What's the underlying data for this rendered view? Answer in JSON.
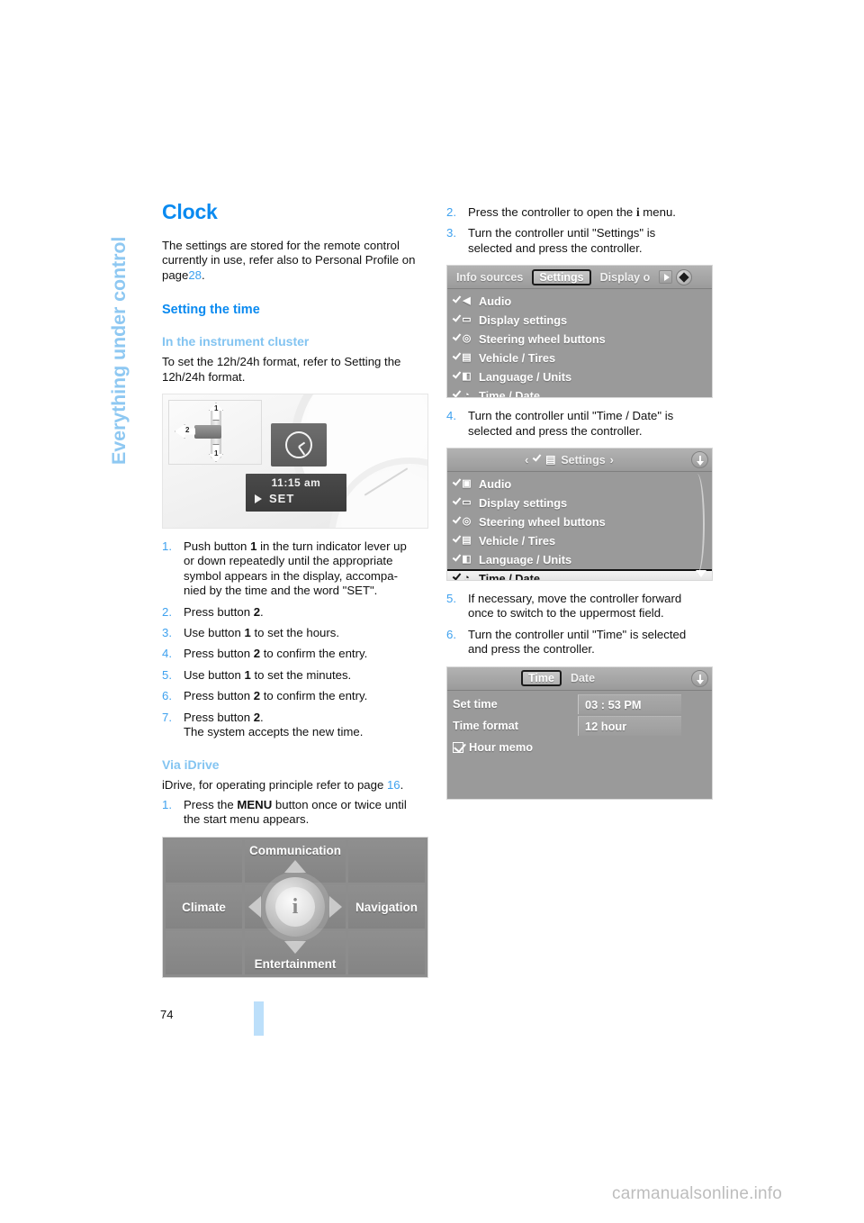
{
  "chapter_tab": {
    "label": "Everything under control"
  },
  "colors": {
    "heading_blue": "#0a8af0",
    "subheading_blue": "#83c4f1",
    "link_blue": "#3ea1ef",
    "page_marker": "#bcdffa",
    "body_text": "#111111"
  },
  "left_column": {
    "title": "Clock",
    "intro": {
      "line1": "The settings are stored for the remote control",
      "line2": "currently in use, refer also to Personal Profile on",
      "line3_pre": "page",
      "line3_page": "28",
      "line3_post": "."
    },
    "section_heading": "Setting the time",
    "subsection_heading": "In the instrument cluster",
    "subsection_body": {
      "line1": "To set the 12h/24h format, refer to Setting the",
      "line2": "12h/24h format."
    },
    "cluster_figure": {
      "name": "instrument-cluster-clock-display",
      "callout_1_up": "1",
      "callout_1_down": "1",
      "callout_2": "2",
      "time_value": "11:15 am",
      "set_label": "SET",
      "figure_id": "WCD11.01.24M"
    },
    "steps": [
      {
        "num": "1.",
        "lines": [
          "Push button 1 in the turn indicator lever up",
          "or down repeatedly until the appropriate",
          "symbol appears in the display, accompa-",
          "nied by the time and the word \"SET\"."
        ]
      },
      {
        "num": "2.",
        "lines": [
          "Press button 2."
        ]
      },
      {
        "num": "3.",
        "lines": [
          "Use button 1 to set the hours."
        ]
      },
      {
        "num": "4.",
        "lines": [
          "Press button 2 to confirm the entry."
        ]
      },
      {
        "num": "5.",
        "lines": [
          "Use button 1 to set the minutes."
        ]
      },
      {
        "num": "6.",
        "lines": [
          "Press button 2 to confirm the entry."
        ]
      },
      {
        "num": "7.",
        "lines": [
          "Press button 2.",
          "The system accepts the new time."
        ]
      }
    ],
    "idrive_heading": "Via iDrive",
    "idrive_body": {
      "pre": "iDrive, for operating principle refer to page",
      "page": "16",
      "post": "."
    },
    "idrive_step1": {
      "num": "1.",
      "pre": "Press the",
      "bold": "MENU",
      "post": "button once or twice until",
      "line2": "the start menu appears."
    },
    "start_menu_figure": {
      "name": "idrive-start-menu",
      "top": "Communication",
      "left": "Climate",
      "right": "Navigation",
      "bottom": "Entertainment",
      "center_icon": "i",
      "figure_id": "MR820GB.book"
    }
  },
  "right_column": {
    "steps_top": [
      {
        "num": "2.",
        "lines": [
          "Press the controller to open the i menu."
        ],
        "pre": "Press the controller to open the",
        "icon": "i",
        "post": "menu."
      },
      {
        "num": "3.",
        "lines": [
          "Turn the controller until \"Settings\" is",
          "selected and press the controller."
        ]
      }
    ],
    "settings_screen": {
      "name": "idrive-settings-menu",
      "tabs": [
        {
          "label": "Info sources",
          "selected": false
        },
        {
          "label": "Settings",
          "selected": true
        },
        {
          "label": "Display o",
          "selected": false
        }
      ],
      "rows": [
        {
          "label": "Audio",
          "icon": "speaker-icon",
          "glyph": "◀",
          "selected": false
        },
        {
          "label": "Display settings",
          "icon": "screen-icon",
          "glyph": "▭",
          "selected": false
        },
        {
          "label": "Steering wheel buttons",
          "icon": "steering-wheel-icon",
          "glyph": "◎",
          "selected": false
        },
        {
          "label": "Vehicle / Tires",
          "icon": "car-icon",
          "glyph": "▤",
          "selected": false
        },
        {
          "label": "Language / Units",
          "icon": "flag-icon",
          "glyph": "◧",
          "selected": false
        },
        {
          "label": "Time / Date",
          "icon": "clock-icon",
          "glyph": "◔",
          "selected": false
        }
      ],
      "figure_id": "MR820GB.book"
    },
    "step_4": {
      "num": "4.",
      "lines": [
        "Turn the controller until \"Time / Date\" is",
        "selected and press the controller."
      ]
    },
    "settings_list_screen": {
      "name": "idrive-settings-list",
      "header": "Settings",
      "header_prev": "‹",
      "header_next": "›",
      "rows": [
        {
          "label": "Audio",
          "glyph": "▣",
          "selected": false
        },
        {
          "label": "Display settings",
          "glyph": "▭",
          "selected": false
        },
        {
          "label": "Steering wheel buttons",
          "glyph": "◎",
          "selected": false
        },
        {
          "label": "Vehicle / Tires",
          "glyph": "▤",
          "selected": false
        },
        {
          "label": "Language / Units",
          "glyph": "◧",
          "selected": false
        },
        {
          "label": "Time / Date",
          "glyph": "◔",
          "selected": true
        }
      ],
      "figure_id": "MR820GB.book"
    },
    "step_5": {
      "num": "5.",
      "lines": [
        "If necessary, move the controller forward",
        "once to switch to the uppermost field."
      ]
    },
    "step_6": {
      "num": "6.",
      "lines": [
        "Turn the controller until \"Time\" is selected",
        "and press the controller."
      ]
    },
    "time_date_screen": {
      "name": "idrive-time-date-screen",
      "tabs": [
        {
          "label": "Time",
          "selected": true
        },
        {
          "label": "Date",
          "selected": false
        }
      ],
      "fields": [
        {
          "key": "Set time",
          "value": "03 : 53 PM"
        },
        {
          "key": "Time format",
          "value": "12 hour"
        }
      ],
      "checkbox": {
        "label": "Hour memo",
        "checked": true
      },
      "figure_id": "MR820GB.book"
    }
  },
  "footer": {
    "page_number": "74",
    "watermark": "carmanualsonline.info"
  }
}
